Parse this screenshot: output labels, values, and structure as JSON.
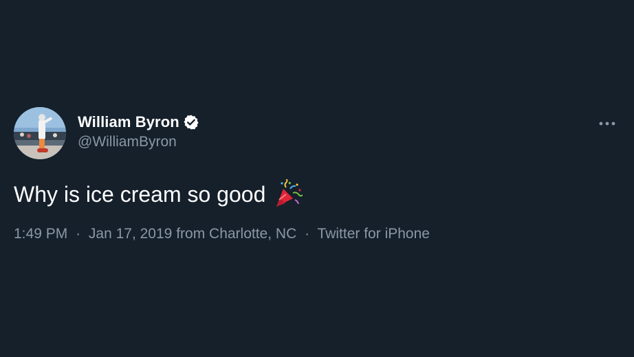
{
  "tweet": {
    "author": {
      "display_name": "William Byron",
      "handle": "@WilliamByron",
      "verified_icon": "verified-badge-icon",
      "avatar": "avatar"
    },
    "more_icon": "more-options-icon",
    "text": "Why is ice cream so good",
    "emoji": "party-popper-icon",
    "meta": {
      "time": "1:49 PM",
      "separator": "·",
      "date": "Jan 17, 2019",
      "location": "from Charlotte, NC",
      "source": "Twitter for iPhone"
    }
  },
  "colors": {
    "background": "#15202b",
    "primary_text": "#ffffff",
    "secondary_text": "#8b98a5"
  }
}
